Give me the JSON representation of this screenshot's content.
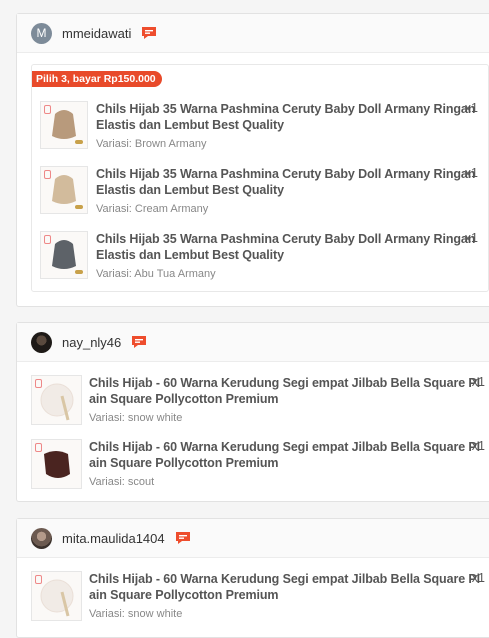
{
  "orders": [
    {
      "username": "mmeidawati",
      "avatar_letter": "M",
      "promo_label": "Pilih 3, bayar Rp150.000",
      "items": [
        {
          "title_line1": "Chils Hijab 35 Warna Pashmina Ceruty Baby Doll Armany Ringan",
          "title_line2": "Elastis dan Lembut Best Quality",
          "qty": "x1",
          "variant": "Variasi: Brown Armany",
          "swatch": "#b89a7c"
        },
        {
          "title_line1": "Chils Hijab 35 Warna Pashmina Ceruty Baby Doll Armany Ringan",
          "title_line2": "Elastis dan Lembut Best Quality",
          "qty": "x1",
          "variant": "Variasi: Cream Armany",
          "swatch": "#d2bb9c"
        },
        {
          "title_line1": "Chils Hijab 35 Warna Pashmina Ceruty Baby Doll Armany Ringan",
          "title_line2": "Elastis dan Lembut Best Quality",
          "qty": "x1",
          "variant": "Variasi: Abu Tua Armany",
          "swatch": "#5d6268"
        }
      ]
    },
    {
      "username": "nay_nly46",
      "items": [
        {
          "title_line1": "Chils Hijab - 60 Warna Kerudung Segi empat Jilbab Bella Square Pl",
          "title_line2": "ain Square Pollycotton Premium",
          "qty": "x1",
          "variant": "Variasi: snow white",
          "swatch": "#f1ebe6"
        },
        {
          "title_line1": "Chils Hijab - 60 Warna Kerudung Segi empat Jilbab Bella Square Pl",
          "title_line2": "ain Square Pollycotton Premium",
          "qty": "x1",
          "variant": "Variasi: scout",
          "swatch": "#4a2420"
        }
      ]
    },
    {
      "username": "mita.maulida1404",
      "items": [
        {
          "title_line1": "Chils Hijab - 60 Warna Kerudung Segi empat Jilbab Bella Square Pl",
          "title_line2": "ain Square Pollycotton Premium",
          "qty": "x1",
          "variant": "Variasi: snow white",
          "swatch": "#f1ebe6"
        }
      ]
    }
  ],
  "colors": {
    "accent": "#ee4d2d",
    "promo": "#e84a2a"
  },
  "icons": {
    "chat": "chat-bubble-icon"
  }
}
